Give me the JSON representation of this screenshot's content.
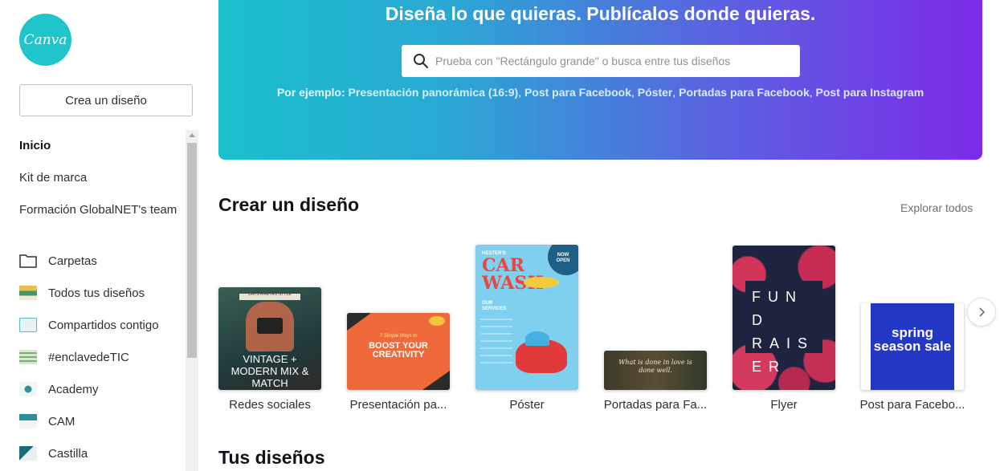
{
  "sidebar": {
    "logo_text": "Canva",
    "create_button": "Crea un diseño",
    "nav": [
      {
        "label": "Inicio",
        "active": true
      },
      {
        "label": "Kit de marca"
      },
      {
        "label": "Formación GlobalNET's team"
      }
    ],
    "folders": [
      {
        "label": "Carpetas",
        "icon": "folder-icon"
      },
      {
        "label": "Todos tus diseños",
        "icon": "design-thumbnail"
      },
      {
        "label": "Compartidos contigo",
        "icon": "design-thumbnail"
      },
      {
        "label": "#enclavedeTIC",
        "icon": "design-thumbnail"
      },
      {
        "label": "Academy",
        "icon": "design-thumbnail"
      },
      {
        "label": "CAM",
        "icon": "design-thumbnail"
      },
      {
        "label": "Castilla",
        "icon": "design-thumbnail"
      }
    ]
  },
  "hero": {
    "title": "Diseña lo que quieras. Publícalos donde quieras.",
    "search_placeholder": "Prueba con \"Rectángulo grande\" o busca entre tus diseños",
    "examples_label": "Por ejemplo:",
    "examples": [
      "Presentación panorámica (16:9)",
      "Post para Facebook",
      "Póster",
      "Portadas para Facebook",
      "Post para Instagram"
    ],
    "gradient": [
      "#19c0cc",
      "#7d2ae8"
    ]
  },
  "create_section": {
    "title": "Crear un diseño",
    "explore_all": "Explorar todos",
    "templates": [
      {
        "caption": "Redes sociales",
        "thumb_text": "VINTAGE + MODERN MIX & MATCH",
        "thumb_small": "DAYS A RETRO STYLE"
      },
      {
        "caption": "Presentación pa...",
        "thumb_text": "BOOST YOUR CREATIVITY",
        "thumb_small": "7 Simple Ways to"
      },
      {
        "caption": "Póster",
        "thumb_text": "CAR WASH",
        "thumb_small": "HESTER'S",
        "badge": "NOW OPEN",
        "services": "OUR SERVICES"
      },
      {
        "caption": "Portadas para Fa...",
        "thumb_text": "What is done in love is done well."
      },
      {
        "caption": "Flyer",
        "thumb_text": "FUND RAISER"
      },
      {
        "caption": "Post para Facebo...",
        "thumb_text": "spring season sale"
      }
    ]
  },
  "your_designs": {
    "title": "Tus diseños"
  }
}
